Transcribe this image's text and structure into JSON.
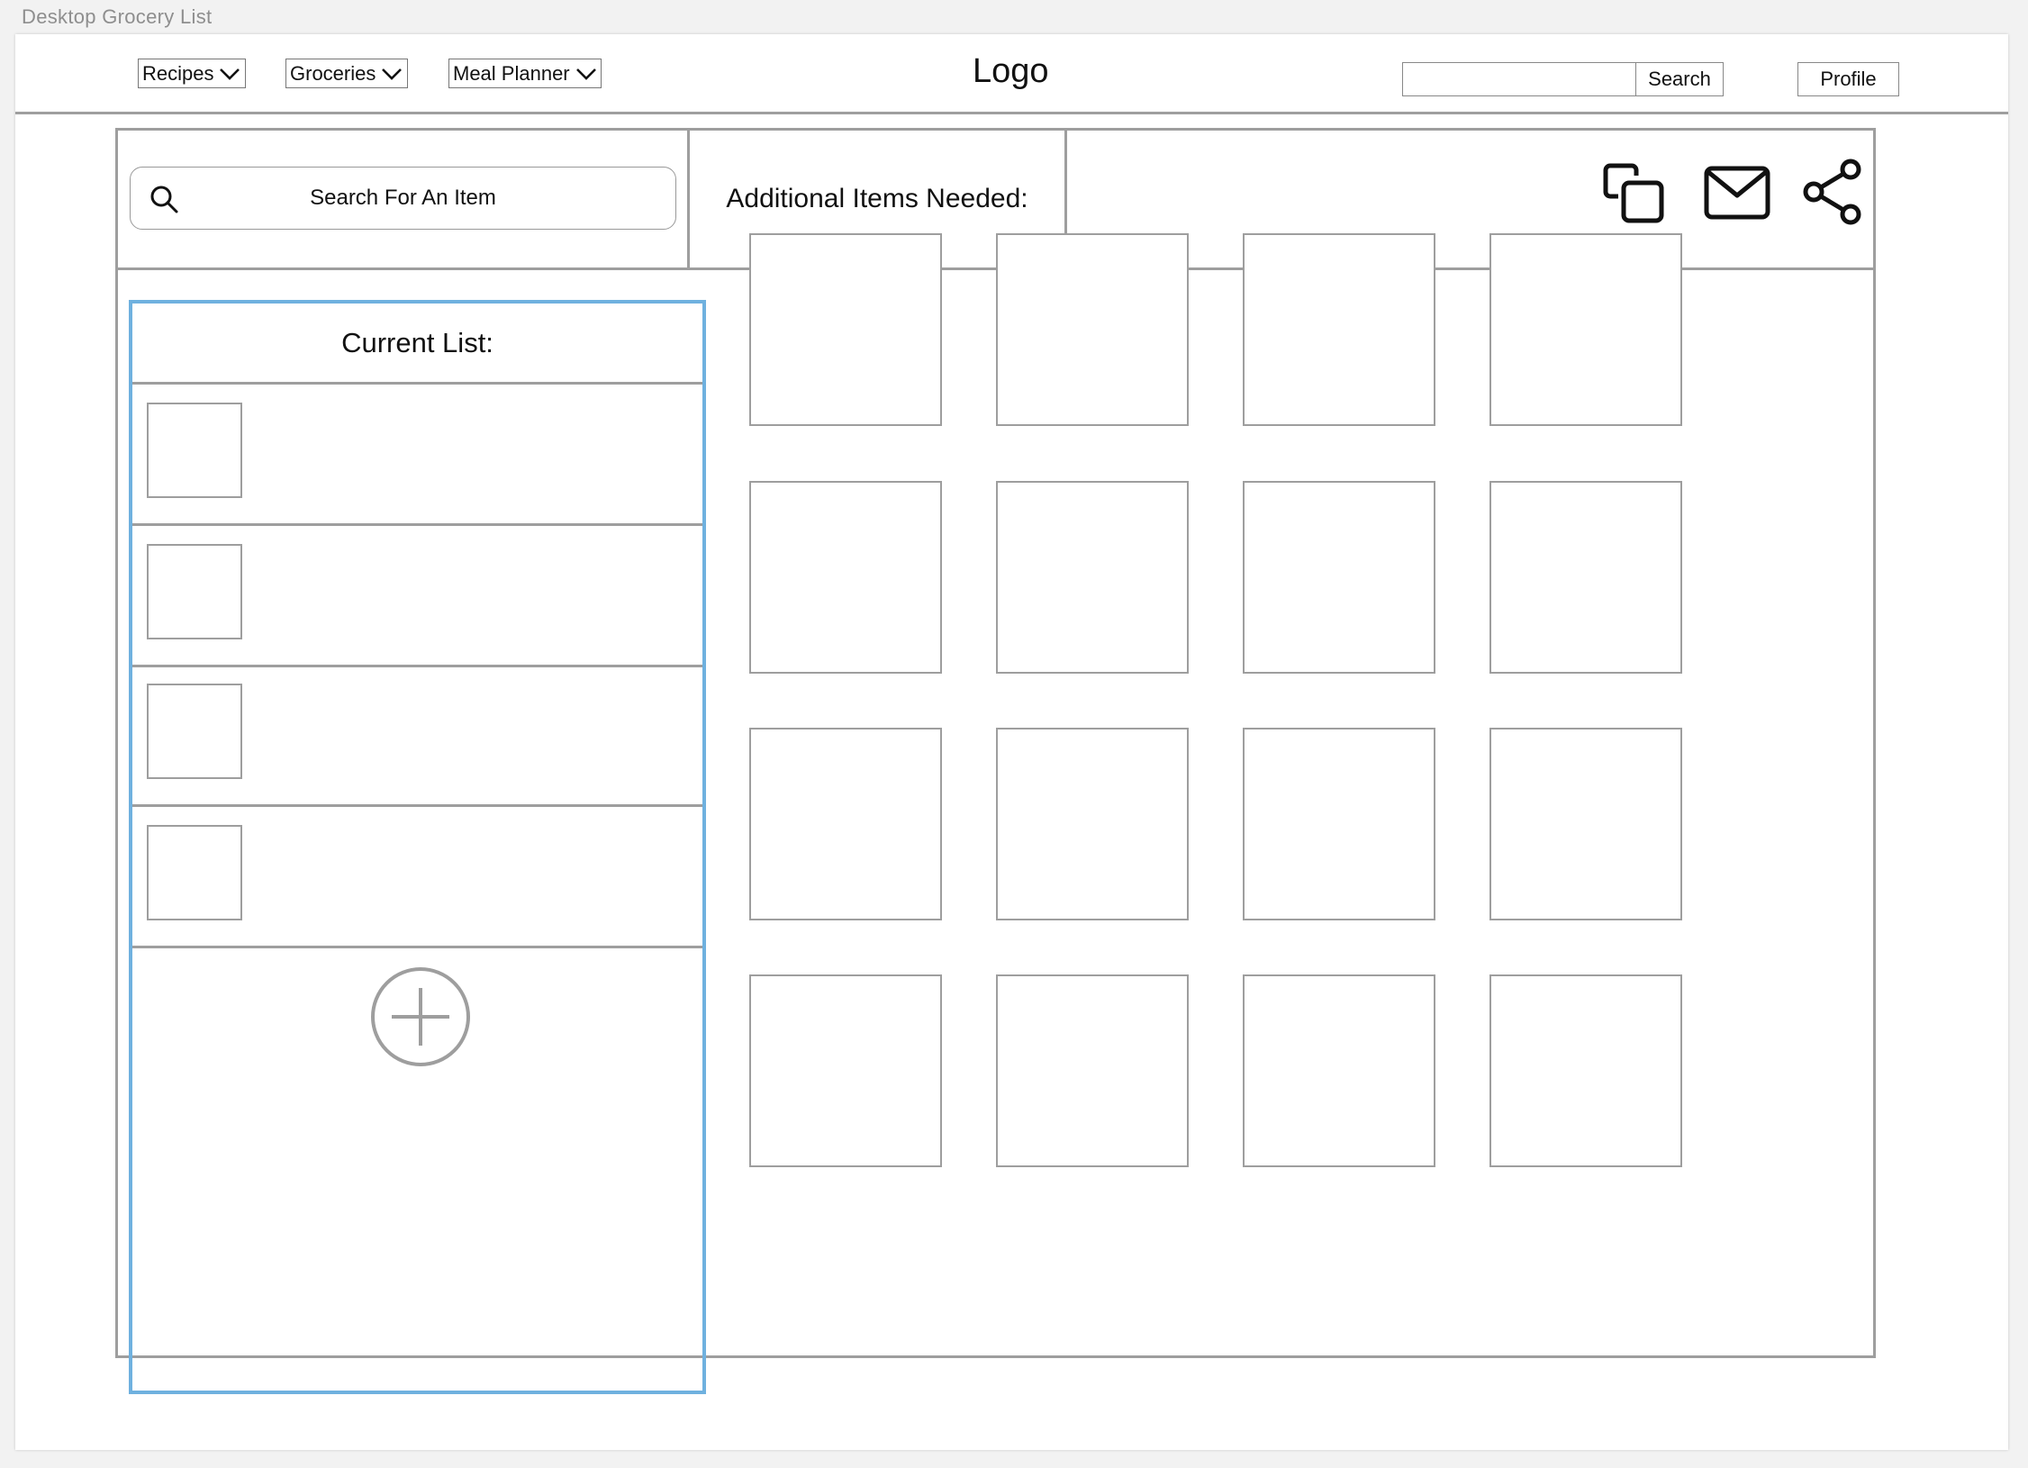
{
  "page_label": "Desktop Grocery List",
  "nav": {
    "menus": [
      "Recipes",
      "Groceries",
      "Meal Planner"
    ],
    "logo": "Logo",
    "search_value": "",
    "search_button": "Search",
    "profile_button": "Profile"
  },
  "toolbar": {
    "item_search_placeholder": "Search For An Item",
    "additional_label": "Additional Items Needed:",
    "actions": [
      "copy-icon",
      "mail-icon",
      "share-icon"
    ]
  },
  "current_list": {
    "title": "Current List:",
    "item_count": 4,
    "add_icon": "plus-circle-icon"
  },
  "items_grid": {
    "rows": 4,
    "columns": 4
  },
  "colors": {
    "wire_gray": "#9e9e9e",
    "selection_blue": "#6fb1df",
    "canvas_bg": "#f2f2f2"
  }
}
